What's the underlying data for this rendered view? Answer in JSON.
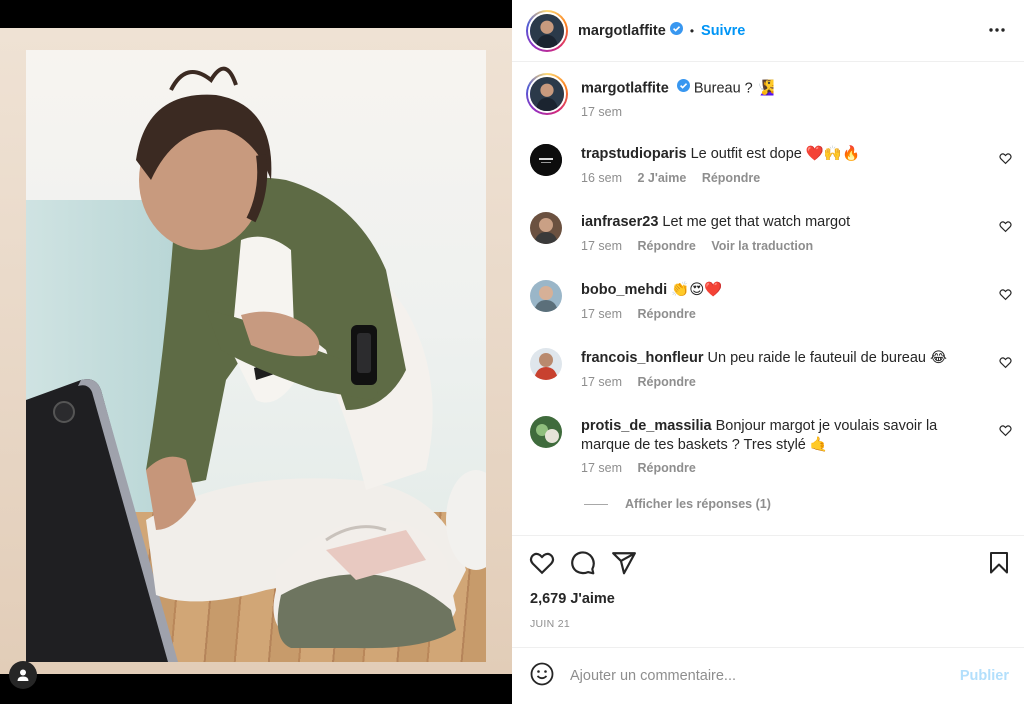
{
  "post": {
    "author": "margotlaffite",
    "verified_icon": "verified-badge-icon",
    "follow_label": "Suivre",
    "separator": "•",
    "caption_text": "Bureau ? 🧏‍♀️",
    "caption_time": "17 sem"
  },
  "comments": [
    {
      "user": "trapstudioparis",
      "text": "Le outfit est dope ❤️🙌🔥",
      "time": "16 sem",
      "likes": "2 J'aime",
      "reply": "Répondre",
      "translate": ""
    },
    {
      "user": "ianfraser23",
      "text": "Let me get that watch margot",
      "time": "17 sem",
      "likes": "",
      "reply": "Répondre",
      "translate": "Voir la traduction"
    },
    {
      "user": "bobo_mehdi",
      "text": "👏😍❤️",
      "time": "17 sem",
      "likes": "",
      "reply": "Répondre",
      "translate": ""
    },
    {
      "user": "francois_honfleur",
      "text": "Un peu raide le fauteuil de bureau 😂",
      "time": "17 sem",
      "likes": "",
      "reply": "Répondre",
      "translate": ""
    },
    {
      "user": "protis_de_massilia",
      "text": "Bonjour margot je voulais savoir la marque de tes baskets ? Tres stylé 🤙",
      "time": "17 sem",
      "likes": "",
      "reply": "Répondre",
      "translate": ""
    }
  ],
  "view_replies": "Afficher les réponses (1)",
  "actions": {
    "like_icon": "heart-icon",
    "comment_icon": "comment-icon",
    "share_icon": "share-icon",
    "save_icon": "bookmark-icon"
  },
  "likes_count": "2,679 J'aime",
  "date": "JUIN 21",
  "add_comment": {
    "placeholder": "Ajouter un commentaire...",
    "publish_label": "Publier"
  },
  "colors": {
    "link_blue": "#0095f6",
    "publish_disabled": "#b2dffc",
    "muted": "#8e8e8e",
    "verified": "#3897f0"
  }
}
